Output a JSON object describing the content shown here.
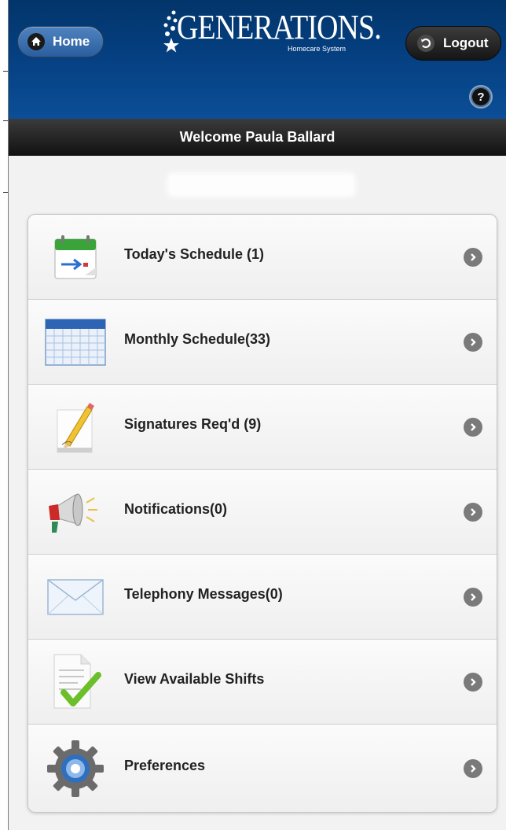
{
  "header": {
    "home_label": "Home",
    "logout_label": "Logout",
    "logo_text": "GENERATIONS.",
    "logo_subtitle": "Homecare System",
    "help_label": "?"
  },
  "welcome": {
    "text": "Welcome Paula Ballard"
  },
  "menu": {
    "items": [
      {
        "label": "Today's Schedule (1)",
        "icon": "calendar-today-icon"
      },
      {
        "label": "Monthly Schedule(33)",
        "icon": "calendar-month-icon"
      },
      {
        "label": "Signatures Req'd (9)",
        "icon": "signature-pencil-icon"
      },
      {
        "label": "Notifications(0)",
        "icon": "megaphone-icon"
      },
      {
        "label": "Telephony Messages(0)",
        "icon": "envelope-icon"
      },
      {
        "label": "View Available Shifts",
        "icon": "document-check-icon"
      },
      {
        "label": "Preferences",
        "icon": "gear-icon"
      }
    ]
  },
  "colors": {
    "header_top": "#02356a",
    "header_bottom": "#0b4e97",
    "welcome_bar": "#1e1e1e",
    "chevron": "#7a7a7a"
  }
}
